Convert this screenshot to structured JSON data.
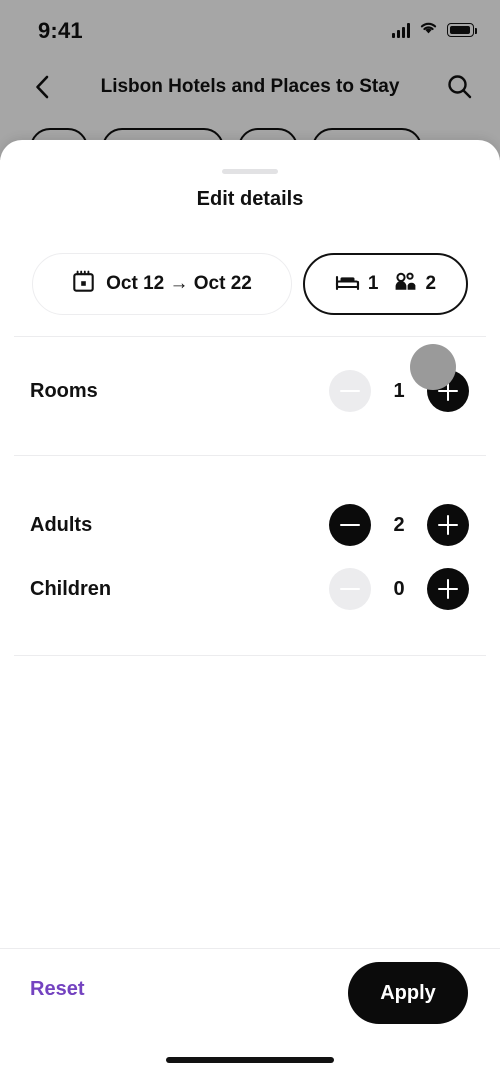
{
  "status_bar": {
    "time": "9:41",
    "signal_icon": "cellular-bars-icon",
    "wifi_icon": "wifi-icon",
    "battery_icon": "battery-full-icon"
  },
  "nav_bar": {
    "back_icon": "chevron-left-icon",
    "title": "Lisbon Hotels and Places to Stay",
    "search_icon": "search-icon"
  },
  "background_chips": [
    {
      "label": ""
    },
    {
      "label": ""
    },
    {
      "label": ""
    },
    {
      "label": ""
    }
  ],
  "sheet": {
    "grabber": "drag-handle",
    "title": "Edit details",
    "pills": {
      "dates": {
        "icon": "calendar-icon",
        "value": "Oct 12 → Oct 22",
        "start": "Oct 12",
        "end": "Oct 22"
      },
      "guests": {
        "rooms_icon": "bed-icon",
        "rooms_value": "1",
        "guests_icon": "people-icon",
        "guests_value": "2"
      }
    },
    "rows": [
      {
        "label": "Rooms",
        "value": "1",
        "decrement_label": "−",
        "increment_label": "+",
        "decrement_enabled": false,
        "increment_enabled": true
      },
      {
        "label": "Adults",
        "value": "2",
        "decrement_label": "−",
        "increment_label": "+",
        "decrement_enabled": true,
        "increment_enabled": true
      },
      {
        "label": "Children",
        "value": "0",
        "decrement_label": "−",
        "increment_label": "+",
        "decrement_enabled": false,
        "increment_enabled": true
      }
    ]
  },
  "footer": {
    "reset_label": "Reset",
    "apply_label": "Apply"
  },
  "colors": {
    "accent_purple": "#7443c0",
    "primary_black": "#0b0b0b",
    "disabled_gray": "#ececee",
    "touch_indicator": "#9a9a9a",
    "divider": "#ececee",
    "scrim": "rgba(0,0,0,0.35)"
  }
}
